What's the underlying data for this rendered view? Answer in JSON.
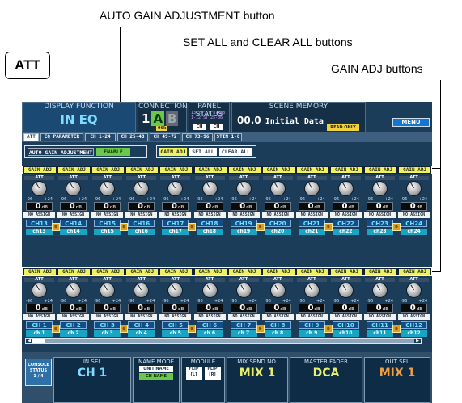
{
  "callouts": {
    "auto_gain": "AUTO GAIN ADJUSTMENT button",
    "set_clear": "SET ALL and CLEAR ALL buttons",
    "gain_adj": "GAIN ADJ buttons",
    "att": "ATT"
  },
  "header": {
    "display_function_label": "DISPLAY FUNCTION",
    "display_function_value": "IN EQ",
    "connection_label": "CONNECTION",
    "connection_num": "1",
    "connection_a": "A",
    "connection_b": "B",
    "connection_sub": "96k",
    "panel_status_label": "PANEL STATUS",
    "panel_status_lines": [
      "13-24",
      "1-12"
    ],
    "panel_status_values": [
      "ST 37-48",
      "ST 25-36"
    ],
    "panel_ch_a": "CH",
    "panel_ch_b": "CH",
    "scene_memory_label": "SCENE MEMORY",
    "scene_number": "00.0",
    "scene_title": "Initial Data",
    "read_only": "READ ONLY",
    "menu": "MENU"
  },
  "tabs": [
    "ATT",
    "EQ PARAMETER",
    "CH 1-24",
    "CH 25-48",
    "CH 49-72",
    "CH 73-96",
    "STIN 1-8"
  ],
  "controls": {
    "auto_gain_label": "AUTO GAIN ADJUSTMENT",
    "enable": "ENABLE",
    "gain_adj": "GAIN ADJ",
    "set_all": "SET ALL",
    "clear_all": "CLEAR ALL"
  },
  "gain_adj_label": "GAIN ADJ",
  "att_label": "ATT",
  "scale_min": "-96",
  "scale_max": "+24",
  "db_unit": "dB",
  "no_assign": "NO ASSIGN",
  "pair_icon_text": "⊗",
  "top_channels": [
    {
      "ch": "CH13",
      "name": "ch13",
      "value": "0"
    },
    {
      "ch": "CH14",
      "name": "ch14",
      "value": "0"
    },
    {
      "ch": "CH15",
      "name": "ch15",
      "value": "0"
    },
    {
      "ch": "CH16",
      "name": "ch16",
      "value": "0"
    },
    {
      "ch": "CH17",
      "name": "ch17",
      "value": "0"
    },
    {
      "ch": "CH18",
      "name": "ch18",
      "value": "0"
    },
    {
      "ch": "CH19",
      "name": "ch19",
      "value": "0"
    },
    {
      "ch": "CH20",
      "name": "ch20",
      "value": "0"
    },
    {
      "ch": "CH21",
      "name": "ch21",
      "value": "0"
    },
    {
      "ch": "CH22",
      "name": "ch22",
      "value": "0"
    },
    {
      "ch": "CH23",
      "name": "ch23",
      "value": "0"
    },
    {
      "ch": "CH24",
      "name": "ch24",
      "value": "0"
    }
  ],
  "bottom_channels": [
    {
      "ch": "CH 1",
      "name": "ch 1",
      "value": "0"
    },
    {
      "ch": "CH 2",
      "name": "ch 2",
      "value": "0"
    },
    {
      "ch": "CH 3",
      "name": "ch 3",
      "value": "0"
    },
    {
      "ch": "CH 4",
      "name": "ch 4",
      "value": "0"
    },
    {
      "ch": "CH 5",
      "name": "ch 5",
      "value": "0"
    },
    {
      "ch": "CH 6",
      "name": "ch 6",
      "value": "0"
    },
    {
      "ch": "CH 7",
      "name": "ch 7",
      "value": "0"
    },
    {
      "ch": "CH 8",
      "name": "ch 8",
      "value": "0"
    },
    {
      "ch": "CH 9",
      "name": "ch 9",
      "value": "0"
    },
    {
      "ch": "CH10",
      "name": "ch10",
      "value": "0"
    },
    {
      "ch": "CH11",
      "name": "ch11",
      "value": "0"
    },
    {
      "ch": "CH12",
      "name": "ch12",
      "value": "0"
    }
  ],
  "bottom_bar": {
    "console_status": [
      "CONSOLE",
      "STATUS",
      "1 / 4"
    ],
    "in_sel_label": "IN SEL",
    "in_sel_value": "CH 1",
    "name_mode_label": "NAME MODE",
    "unit_name": "UNIT NAME",
    "ch_name": "CH NAME",
    "module_label": "MODULE",
    "flip_l": "FLIP [L]",
    "flip_r": "FLIP [R]",
    "mix_send_label": "MIX SEND NO.",
    "mix_send_value": "MIX 1",
    "master_fader_label": "MASTER FADER",
    "master_fader_value": "DCA",
    "out_sel_label": "OUT SEL",
    "out_sel_value": "MIX 1"
  },
  "colors": {
    "screen_bg": "#1b3d5a",
    "gain_adj_button": "#f2f05f",
    "enable_green": "#6cc84a",
    "read_only": "#f2d23c",
    "mix_yellow": "#e8f06a",
    "out_orange": "#f0a040"
  }
}
